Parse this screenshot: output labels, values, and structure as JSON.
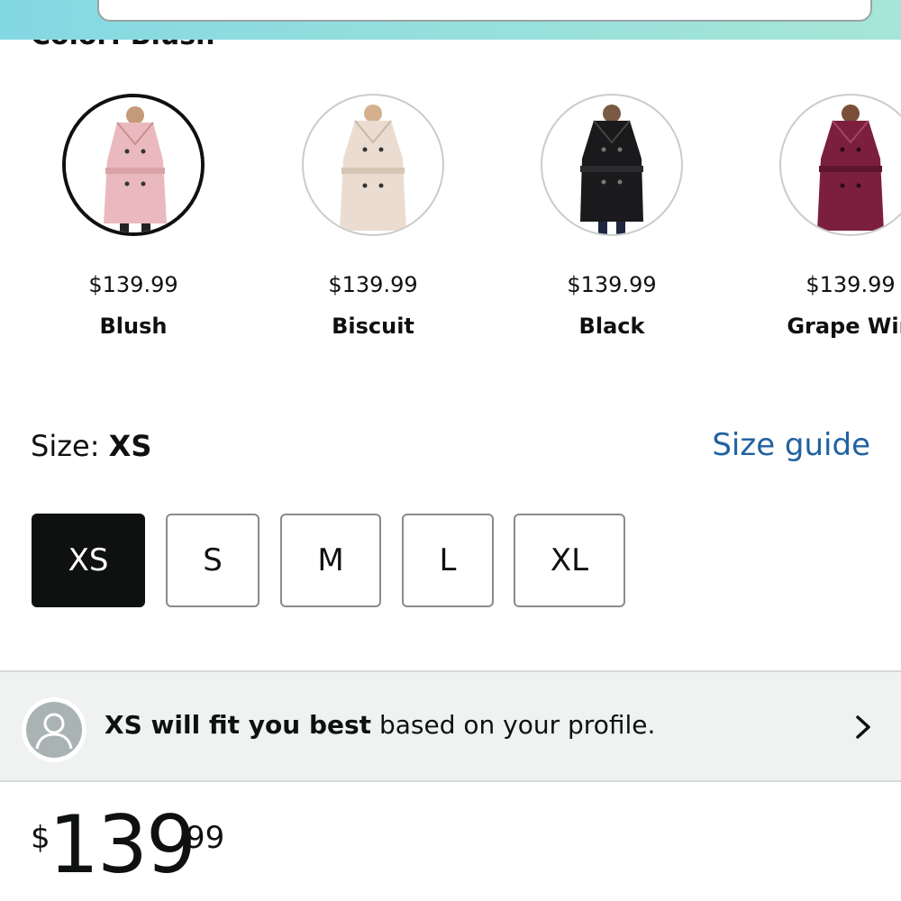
{
  "header": {
    "search_placeholder": ""
  },
  "color": {
    "label": "Color: Blush",
    "swatches": [
      {
        "name": "Blush",
        "price": "$139.99",
        "coat_color": "#eab9bd",
        "belt_color": "#d9a3a8",
        "selected": true
      },
      {
        "name": "Biscuit",
        "price": "$139.99",
        "coat_color": "#eadcd0",
        "belt_color": "#d7c6b6",
        "selected": false
      },
      {
        "name": "Black",
        "price": "$139.99",
        "coat_color": "#1a1a1c",
        "belt_color": "#2b2b2e",
        "selected": false
      },
      {
        "name": "Grape Win",
        "price": "$139.99",
        "coat_color": "#7c1f3e",
        "belt_color": "#5f1530",
        "selected": false
      }
    ]
  },
  "size": {
    "label": "Size: ",
    "value": "XS",
    "guide_link": "Size guide",
    "options": [
      "XS",
      "S",
      "M",
      "L",
      "XL"
    ],
    "selected": "XS"
  },
  "fit": {
    "bold_text": "XS will fit you best",
    "rest_text": " based on your profile.",
    "icon": "user-avatar-icon"
  },
  "price": {
    "symbol": "$",
    "whole": "139",
    "fraction": "99"
  }
}
